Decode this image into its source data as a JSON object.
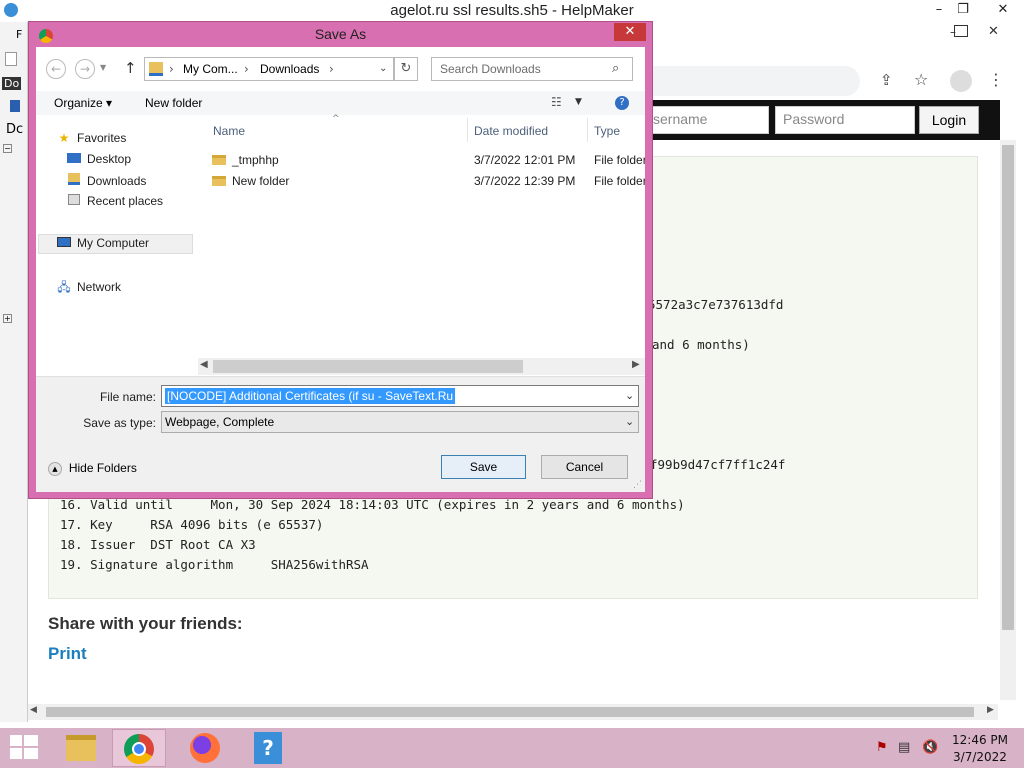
{
  "outer_window": {
    "title": "agelot.ru ssl results.sh5 - HelpMaker",
    "min_glyph": "–",
    "restore_glyph": "❐",
    "close_glyph": "✕"
  },
  "left_strip": {
    "label_1": "F",
    "label_2": "Do",
    "label_3": "Dc"
  },
  "site": {
    "username_placeholder": "sername",
    "password_placeholder": "Password",
    "login_label": "Login"
  },
  "content_lines": [
    "5572a3c7e737613dfd",
    "and 6 months)",
    "f99b9d47cf7ff1c24f",
    "16. Valid until     Mon, 30 Sep 2024 18:14:03 UTC (expires in 2 years and 6 months)",
    "17. Key     RSA 4096 bits (e 65537)",
    "18. Issuer  DST Root CA X3",
    "19. Signature algorithm     SHA256withRSA"
  ],
  "share_title": "Share with your friends:",
  "print_label": "Print",
  "dialog": {
    "title": "Save As",
    "close_glyph": "✕",
    "breadcrumb": {
      "part1": "My Com...",
      "sep": "›",
      "part2": "Downloads"
    },
    "search_placeholder": "Search Downloads",
    "organize_label": "Organize ▾",
    "new_folder_label": "New folder",
    "nav": {
      "favorites": "Favorites",
      "desktop": "Desktop",
      "downloads": "Downloads",
      "recent": "Recent places",
      "my_computer": "My Computer",
      "network": "Network"
    },
    "columns": {
      "name": "Name",
      "date": "Date modified",
      "type": "Type"
    },
    "files": [
      {
        "name": "_tmphhp",
        "date": "3/7/2022 12:01 PM",
        "type": "File folder"
      },
      {
        "name": "New folder",
        "date": "3/7/2022 12:39 PM",
        "type": "File folder"
      }
    ],
    "file_name_label": "File name:",
    "file_name_value": "[NOCODE] Additional Certificates (if su - SaveText.Ru",
    "save_type_label": "Save as type:",
    "save_type_value": "Webpage, Complete",
    "hide_folders_label": "Hide Folders",
    "save_label": "Save",
    "cancel_label": "Cancel"
  },
  "taskbar": {
    "time": "12:46 PM",
    "date": "3/7/2022"
  }
}
